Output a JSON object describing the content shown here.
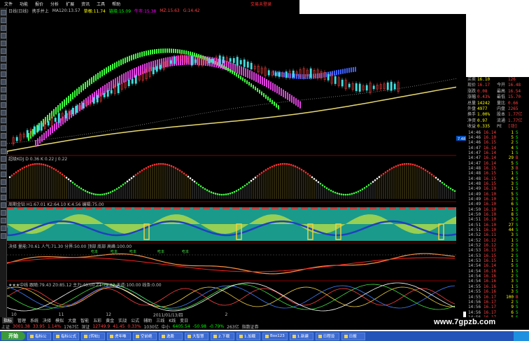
{
  "menubar": {
    "items": [
      "文件",
      "功能",
      "报价",
      "分析",
      "扩展",
      "资讯",
      "工具",
      "帮助"
    ],
    "promo": "交易未登录"
  },
  "quote_header": [
    {
      "text": "日线(日线)",
      "color": "#c0c0c0"
    },
    {
      "text": "携手并上",
      "color": "#c0c0c0"
    },
    {
      "text": "MA120:13.57",
      "color": "#c0c0c0"
    },
    {
      "text": "草根:11.74",
      "color": "#ffff00"
    },
    {
      "text": "链接:15.09",
      "color": "#00ff00"
    },
    {
      "text": "牛市:15.38",
      "color": "#ff00ff"
    },
    {
      "text": "MZ:15.63",
      "color": "#ff4040"
    },
    {
      "text": "G:14.42",
      "color": "#ff4040"
    }
  ],
  "panels": {
    "kdj": {
      "name": "超级KDJ",
      "fields": [
        "D 0.36",
        "K 0.22",
        "J 0.22"
      ]
    },
    "ind2": {
      "name": "周期金钻",
      "fields": [
        "H1:67.01",
        "K2:64.10",
        "K:4.56",
        "编辑:75.00"
      ]
    },
    "ind3": {
      "name": "决择",
      "fields": [
        "量能:70.61",
        "人气:71.30",
        "分界:50.00",
        "顶部",
        "底部",
        "高峰:100.00"
      ],
      "labels": [
        "吃本",
        "吃本",
        "吃本",
        "吃本",
        "吃本"
      ]
    },
    "ind4": {
      "name": "★★★中线",
      "fields": [
        "跟随:79.43",
        "Z0:85.12",
        "主力:40.00",
        "Z1:79.02",
        "天道:100.00",
        "线条:0.00"
      ]
    }
  },
  "axis_labels": [
    "7.48"
  ],
  "timeline": {
    "labels": [
      "10",
      "11",
      "12",
      "2011/01/13/四",
      "2"
    ]
  },
  "tabs": [
    "指标",
    "管理",
    "系统",
    "决择",
    "模拟",
    "大盘",
    "智能",
    "五彩",
    "黄金",
    "实战",
    "公式",
    "辅助",
    "三线",
    "K线",
    "变日"
  ],
  "tabs_active": "指标",
  "statusbar": [
    {
      "text": "上证",
      "color": "#c0c0c0"
    },
    {
      "text": "3001.38",
      "color": "#ff4040"
    },
    {
      "text": "33.95",
      "color": "#ff4040"
    },
    {
      "text": "1.14%",
      "color": "#ff4040"
    },
    {
      "text": "1767亿",
      "color": "#c0c0c0"
    },
    {
      "text": "深证",
      "color": "#c0c0c0"
    },
    {
      "text": "12749.9",
      "color": "#ff4040"
    },
    {
      "text": "41.45",
      "color": "#ff4040"
    },
    {
      "text": "0.33%",
      "color": "#ff4040"
    },
    {
      "text": "1030亿",
      "color": "#c0c0c0"
    },
    {
      "text": "中小",
      "color": "#c0c0c0"
    },
    {
      "text": "6405.54",
      "color": "#00ff00"
    },
    {
      "text": "-50.98",
      "color": "#00ff00"
    },
    {
      "text": "-0.79%",
      "color": "#00ff00"
    },
    {
      "text": "263亿",
      "color": "#c0c0c0"
    },
    {
      "text": "指数证券",
      "color": "#c0c0c0"
    }
  ],
  "side_panel": {
    "header_rows": [
      {
        "l": "买卖",
        "v": "16.10",
        "r": "",
        "rv": "126"
      },
      {
        "l": "现价",
        "v": "16.17",
        "r": "今开",
        "rv": "16.48"
      },
      {
        "l": "涨跌",
        "v": "0.08",
        "r": "最高",
        "rv": "16.54"
      },
      {
        "l": "涨幅",
        "v": "0.43%",
        "r": "最低",
        "rv": "15.70"
      },
      {
        "l": "总量",
        "v": "14242",
        "r": "量比",
        "rv": "0.66"
      },
      {
        "l": "外盘",
        "v": "4977",
        "r": "内盘",
        "rv": "2265"
      },
      {
        "l": "换手",
        "v": "1.00%",
        "r": "股本",
        "rv": "1.77亿"
      },
      {
        "l": "净资",
        "v": "0.97",
        "r": "流通",
        "rv": "1.77亿"
      },
      {
        "l": "收益",
        "v": "0.335",
        "r": "PE",
        "rv": "[动]"
      }
    ],
    "ticks": [
      [
        "14:46",
        "16.14",
        "1",
        "S"
      ],
      [
        "14:46",
        "16.10",
        "5",
        "S"
      ],
      [
        "14:46",
        "16.15",
        "2",
        "S"
      ],
      [
        "14:47",
        "16.14",
        "4",
        "S"
      ],
      [
        "14:47",
        "16.14",
        "1",
        "S"
      ],
      [
        "14:47",
        "16.14",
        "29",
        "B"
      ],
      [
        "14:47",
        "16.14",
        "5",
        "S"
      ],
      [
        "14:48",
        "16.15",
        "3",
        "B"
      ],
      [
        "14:48",
        "16.15",
        "1",
        "S"
      ],
      [
        "14:48",
        "16.15",
        "4",
        "S"
      ],
      [
        "14:48",
        "16.15",
        "3",
        "S"
      ],
      [
        "14:49",
        "16.10",
        "1",
        "S"
      ],
      [
        "14:49",
        "16.10",
        "5",
        "S"
      ],
      [
        "14:49",
        "16.10",
        "3",
        "S"
      ],
      [
        "14:49",
        "16.10",
        "6",
        "S"
      ],
      [
        "14:50",
        "16.10",
        "1",
        "S"
      ],
      [
        "14:50",
        "16.10",
        "8",
        "S"
      ],
      [
        "14:51",
        "16.10",
        "3",
        "S"
      ],
      [
        "14:51",
        "16.10",
        "27",
        "S"
      ],
      [
        "14:51",
        "16.10",
        "44",
        "S"
      ],
      [
        "14:52",
        "16.11",
        "3",
        "S"
      ],
      [
        "14:52",
        "16.12",
        "1",
        "S"
      ],
      [
        "14:52",
        "16.12",
        "2",
        "S"
      ],
      [
        "14:53",
        "16.13",
        "3",
        "S"
      ],
      [
        "14:53",
        "16.15",
        "2",
        "S"
      ],
      [
        "14:53",
        "16.15",
        "1",
        "S"
      ],
      [
        "14:54",
        "16.14",
        "5",
        "S"
      ],
      [
        "14:54",
        "16.16",
        "1",
        "S"
      ],
      [
        "14:54",
        "16.16",
        "2",
        "S"
      ],
      [
        "14:54",
        "16.16",
        "3",
        "S"
      ],
      [
        "14:55",
        "16.16",
        "1",
        "S"
      ],
      [
        "14:55",
        "16.16",
        "3",
        "S"
      ],
      [
        "14:55",
        "16.17",
        "100",
        "B"
      ],
      [
        "14:56",
        "16.17",
        "2",
        "S"
      ],
      [
        "14:56",
        "16.17",
        "9",
        "S"
      ],
      [
        "14:56",
        "16.17",
        "6",
        "S"
      ],
      [
        "14:56",
        "16.17",
        "5",
        "S"
      ]
    ]
  },
  "taskbar": {
    "start": "开始",
    "items": [
      "指标公",
      "指标公式",
      "[转帖]",
      "虎年唯",
      "空前绝",
      "选股",
      "大智慧",
      "2.下载",
      "1.加载",
      "Box123",
      "1.新建",
      "日程设",
      "日报"
    ]
  },
  "watermark": "www.7gpzb.com",
  "colors": {
    "up": "#ff4040",
    "down": "#00ff00",
    "ma": "#ffff00",
    "bg": "#000000"
  }
}
